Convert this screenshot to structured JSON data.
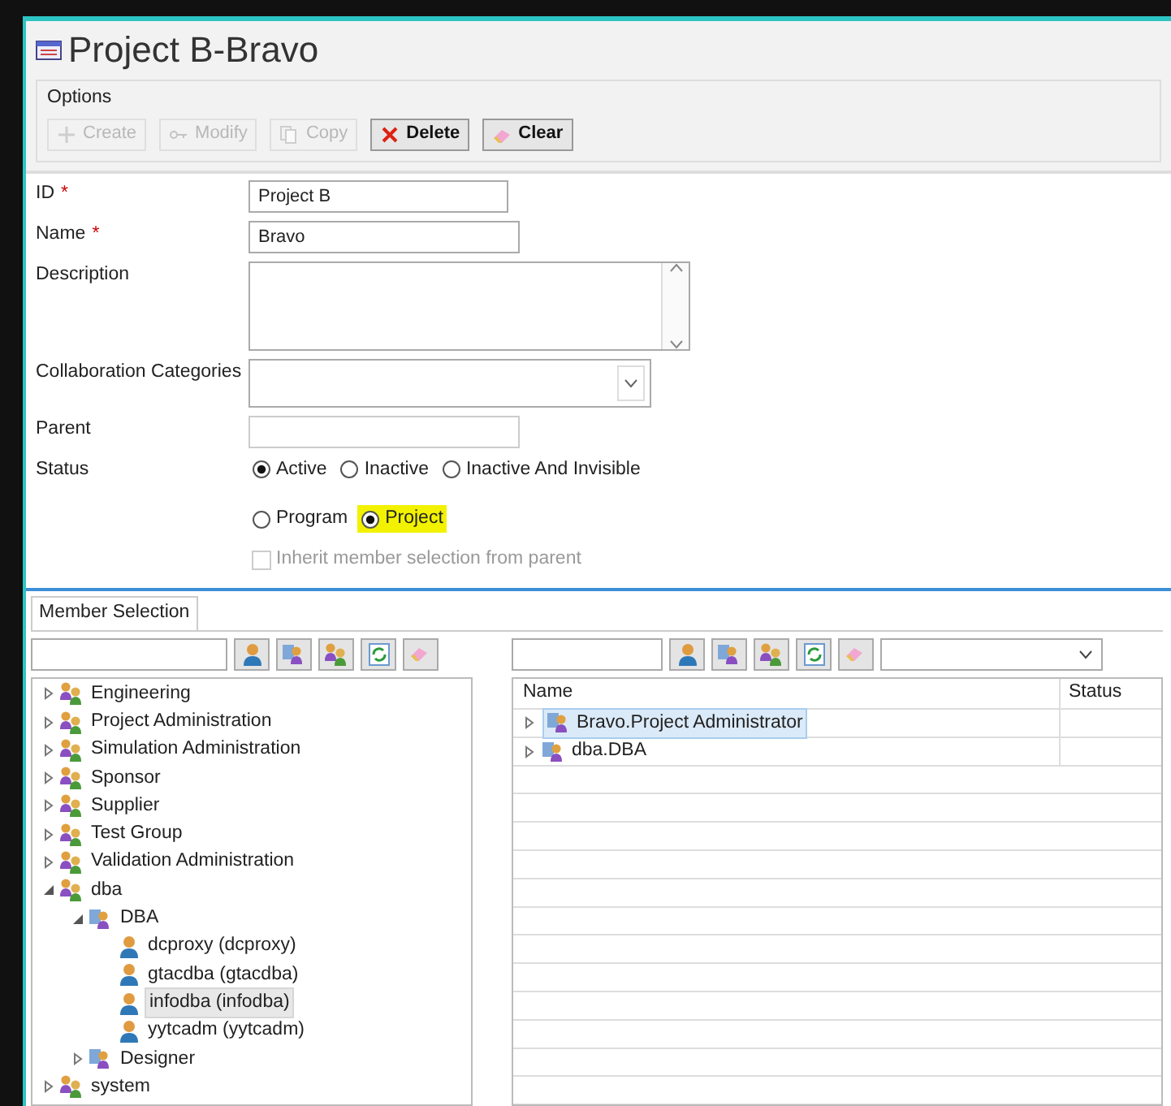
{
  "window": {
    "title": "Project B-Bravo"
  },
  "options": {
    "label": "Options",
    "buttons": [
      {
        "label": "Create",
        "kind": "create",
        "disabled": true
      },
      {
        "label": "Modify",
        "kind": "modify",
        "disabled": true
      },
      {
        "label": "Copy",
        "kind": "copy",
        "disabled": true
      },
      {
        "label": "Delete",
        "kind": "delete",
        "disabled": false
      },
      {
        "label": "Clear",
        "kind": "clear",
        "disabled": false
      }
    ]
  },
  "form": {
    "id": {
      "label": "ID",
      "required_marker": "*",
      "value": "Project B"
    },
    "name": {
      "label": "Name",
      "required_marker": "*",
      "value": "Bravo"
    },
    "description": {
      "label": "Description"
    },
    "collaboration_categories": {
      "label": "Collaboration Categories"
    },
    "parent": {
      "label": "Parent"
    },
    "status": {
      "label": "Status",
      "options": [
        {
          "label": "Active",
          "selected": true
        },
        {
          "label": "Inactive",
          "selected": false
        },
        {
          "label": "Inactive And Invisible",
          "selected": false
        }
      ]
    },
    "type": {
      "options": [
        {
          "label": "Program",
          "selected": false,
          "highlighted": false
        },
        {
          "label": "Project",
          "selected": true,
          "highlighted": true
        }
      ]
    },
    "inherit": {
      "label": "Inherit member selection from parent",
      "checked": false,
      "disabled": true
    }
  },
  "member_selection": {
    "tab": "Member Selection",
    "tree": [
      {
        "label": "Engineering",
        "kind": "group",
        "expanded": false,
        "selected": false
      },
      {
        "label": "Project Administration",
        "kind": "group",
        "expanded": false,
        "selected": false
      },
      {
        "label": "Simulation Administration",
        "kind": "group",
        "expanded": false,
        "selected": false
      },
      {
        "label": "Sponsor",
        "kind": "group",
        "expanded": false,
        "selected": false
      },
      {
        "label": "Supplier",
        "kind": "group",
        "expanded": false,
        "selected": false
      },
      {
        "label": "Test Group",
        "kind": "group",
        "expanded": false,
        "selected": false
      },
      {
        "label": "Validation Administration",
        "kind": "group",
        "expanded": false,
        "selected": false
      },
      {
        "label": "dba",
        "kind": "group",
        "expanded": true,
        "selected": false,
        "children": [
          {
            "label": "DBA",
            "kind": "role",
            "expanded": true,
            "selected": false,
            "children": [
              {
                "label": "dcproxy (dcproxy)",
                "kind": "user",
                "selected": false
              },
              {
                "label": "gtacdba (gtacdba)",
                "kind": "user",
                "selected": false
              },
              {
                "label": "infodba (infodba)",
                "kind": "user",
                "selected": true
              },
              {
                "label": "yytcadm (yytcadm)",
                "kind": "user",
                "selected": false
              }
            ]
          },
          {
            "label": "Designer",
            "kind": "role",
            "expanded": false,
            "selected": false
          }
        ]
      },
      {
        "label": "system",
        "kind": "group",
        "expanded": false,
        "selected": false
      }
    ],
    "table": {
      "columns": [
        "Name",
        "Status"
      ],
      "rows": [
        {
          "name": "Bravo.Project Administrator",
          "kind": "role",
          "expanded": false,
          "selected": true
        },
        {
          "name": "dba.DBA",
          "kind": "role",
          "expanded": false,
          "selected": false
        }
      ]
    }
  }
}
